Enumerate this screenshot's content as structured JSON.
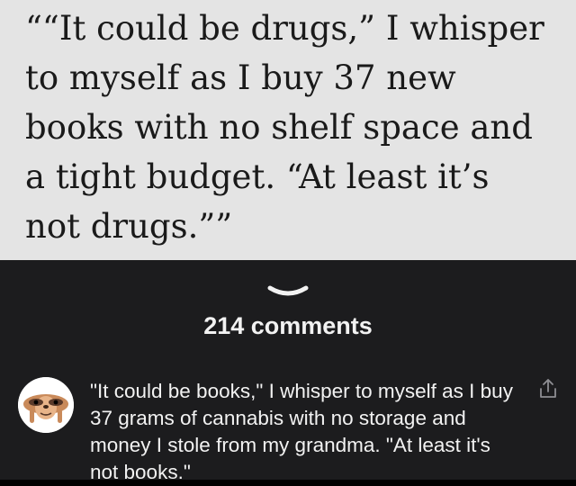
{
  "quote": {
    "text": "““It could be drugs,” I whisper\nto myself as I buy 37 new\nbooks with no shelf space and\na tight budget. “At least it’s\nnot drugs.””"
  },
  "comments": {
    "count_label": "214 comments"
  },
  "comment": {
    "avatar_icon": "sloth-face-icon",
    "text": "\"It could be books,\" I whisper to myself as I buy 37 grams of cannabis with no storage and money I stole from my grandma. \"At least it's not books.\""
  },
  "icons": {
    "collapse": "chevron-down-icon",
    "share": "share-icon"
  },
  "colors": {
    "quote_background": "#e4e4e4",
    "comments_background": "#1c1c1e",
    "text_light": "#f2f2f2"
  }
}
